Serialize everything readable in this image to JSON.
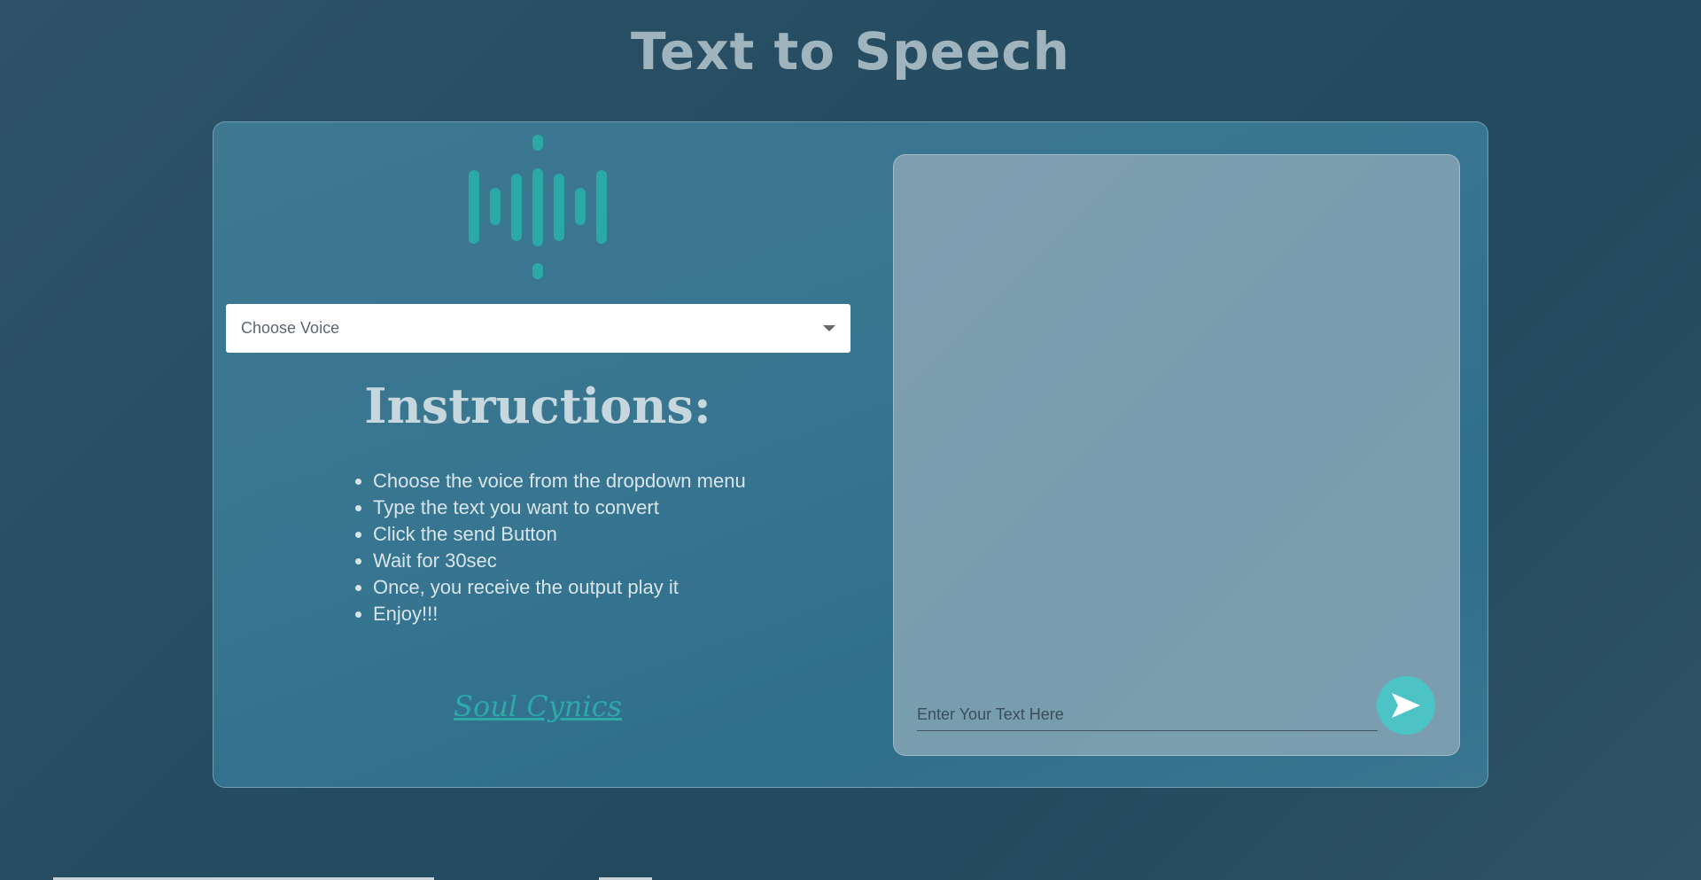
{
  "header": {
    "title": "Text to Speech"
  },
  "left": {
    "icon": "sound-wave-icon",
    "voice_select": {
      "placeholder": "Choose Voice",
      "icon": "chevron-down-icon"
    },
    "instructions": {
      "heading": "Instructions:",
      "items": [
        "Choose the voice from the dropdown menu",
        "Type the text you want to convert",
        "Click the send Button",
        "Wait for 30sec",
        "Once, you receive the output play it",
        "Enjoy!!!"
      ]
    },
    "credit": "Soul Cynics"
  },
  "right": {
    "input_placeholder": "Enter Your Text Here",
    "send_icon": "send-icon"
  },
  "colors": {
    "accent": "#2fb2b0",
    "send_button": "#4cc4c6",
    "title": "#9fb4bd"
  }
}
